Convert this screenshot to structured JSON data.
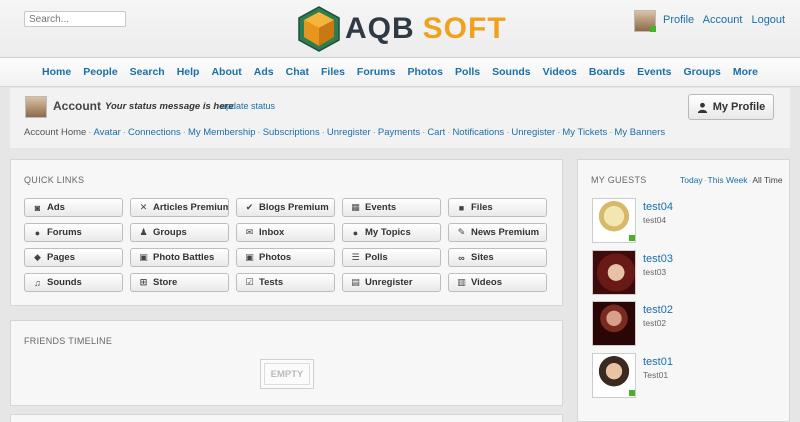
{
  "header": {
    "search_placeholder": "Search...",
    "logo_left": "AQB",
    "logo_right": "SOFT",
    "links": [
      "Profile",
      "Account",
      "Logout"
    ]
  },
  "nav": {
    "items": [
      "Home",
      "People",
      "Search",
      "Help",
      "About",
      "Ads",
      "Chat",
      "Files",
      "Forums",
      "Photos",
      "Polls",
      "Sounds",
      "Videos",
      "Boards",
      "Events",
      "Groups",
      "More"
    ]
  },
  "account": {
    "title": "Account",
    "status": "Your status message is here",
    "update_status": "update status",
    "my_profile_button": "My Profile",
    "links": [
      "Account Home",
      "Avatar",
      "Connections",
      "My Membership",
      "Subscriptions",
      "Unregister",
      "Payments",
      "Cart",
      "Notifications",
      "Unregister",
      "My Tickets",
      "My Banners"
    ]
  },
  "quick_links": {
    "title": "QUICK LINKS",
    "items": [
      {
        "label": "Ads",
        "icon": "ads-icon",
        "glyph": "◙"
      },
      {
        "label": "Articles Premium",
        "icon": "articles-icon",
        "glyph": "✕"
      },
      {
        "label": "Blogs Premium",
        "icon": "blogs-icon",
        "glyph": "✔"
      },
      {
        "label": "Events",
        "icon": "calendar-icon",
        "glyph": "▦"
      },
      {
        "label": "Files",
        "icon": "file-icon",
        "glyph": "■"
      },
      {
        "label": "Forums",
        "icon": "chat-bubble-icon",
        "glyph": "●"
      },
      {
        "label": "Groups",
        "icon": "group-icon",
        "glyph": "♟"
      },
      {
        "label": "Inbox",
        "icon": "envelope-icon",
        "glyph": "✉"
      },
      {
        "label": "My Topics",
        "icon": "comments-icon",
        "glyph": "●"
      },
      {
        "label": "News Premium",
        "icon": "news-icon",
        "glyph": "✎"
      },
      {
        "label": "Pages",
        "icon": "pages-icon",
        "glyph": "◆"
      },
      {
        "label": "Photo Battles",
        "icon": "image-icon",
        "glyph": "▣"
      },
      {
        "label": "Photos",
        "icon": "photo-icon",
        "glyph": "▣"
      },
      {
        "label": "Polls",
        "icon": "list-icon",
        "glyph": "☰"
      },
      {
        "label": "Sites",
        "icon": "link-icon",
        "glyph": "∞"
      },
      {
        "label": "Sounds",
        "icon": "music-icon",
        "glyph": "♫"
      },
      {
        "label": "Store",
        "icon": "cart-icon",
        "glyph": "⊞"
      },
      {
        "label": "Tests",
        "icon": "edit-icon",
        "glyph": "☑"
      },
      {
        "label": "Unregister",
        "icon": "chart-icon",
        "glyph": "▤"
      },
      {
        "label": "Videos",
        "icon": "film-icon",
        "glyph": "▥"
      }
    ]
  },
  "timeline": {
    "title": "FRIENDS TIMELINE",
    "empty": "EMPTY"
  },
  "guests": {
    "title": "MY GUESTS",
    "tabs": [
      "Today",
      "This Week",
      "All Time"
    ],
    "items": [
      {
        "name": "test04",
        "sub": "test04",
        "online": true
      },
      {
        "name": "test03",
        "sub": "test03",
        "online": false
      },
      {
        "name": "test02",
        "sub": "test02",
        "online": false
      },
      {
        "name": "test01",
        "sub": "Test01",
        "online": true
      }
    ]
  },
  "colors": {
    "link": "#1a6fa8",
    "logo_orange": "#f0a21e",
    "logo_dark": "#2f3a44",
    "online": "#4caf2a"
  }
}
